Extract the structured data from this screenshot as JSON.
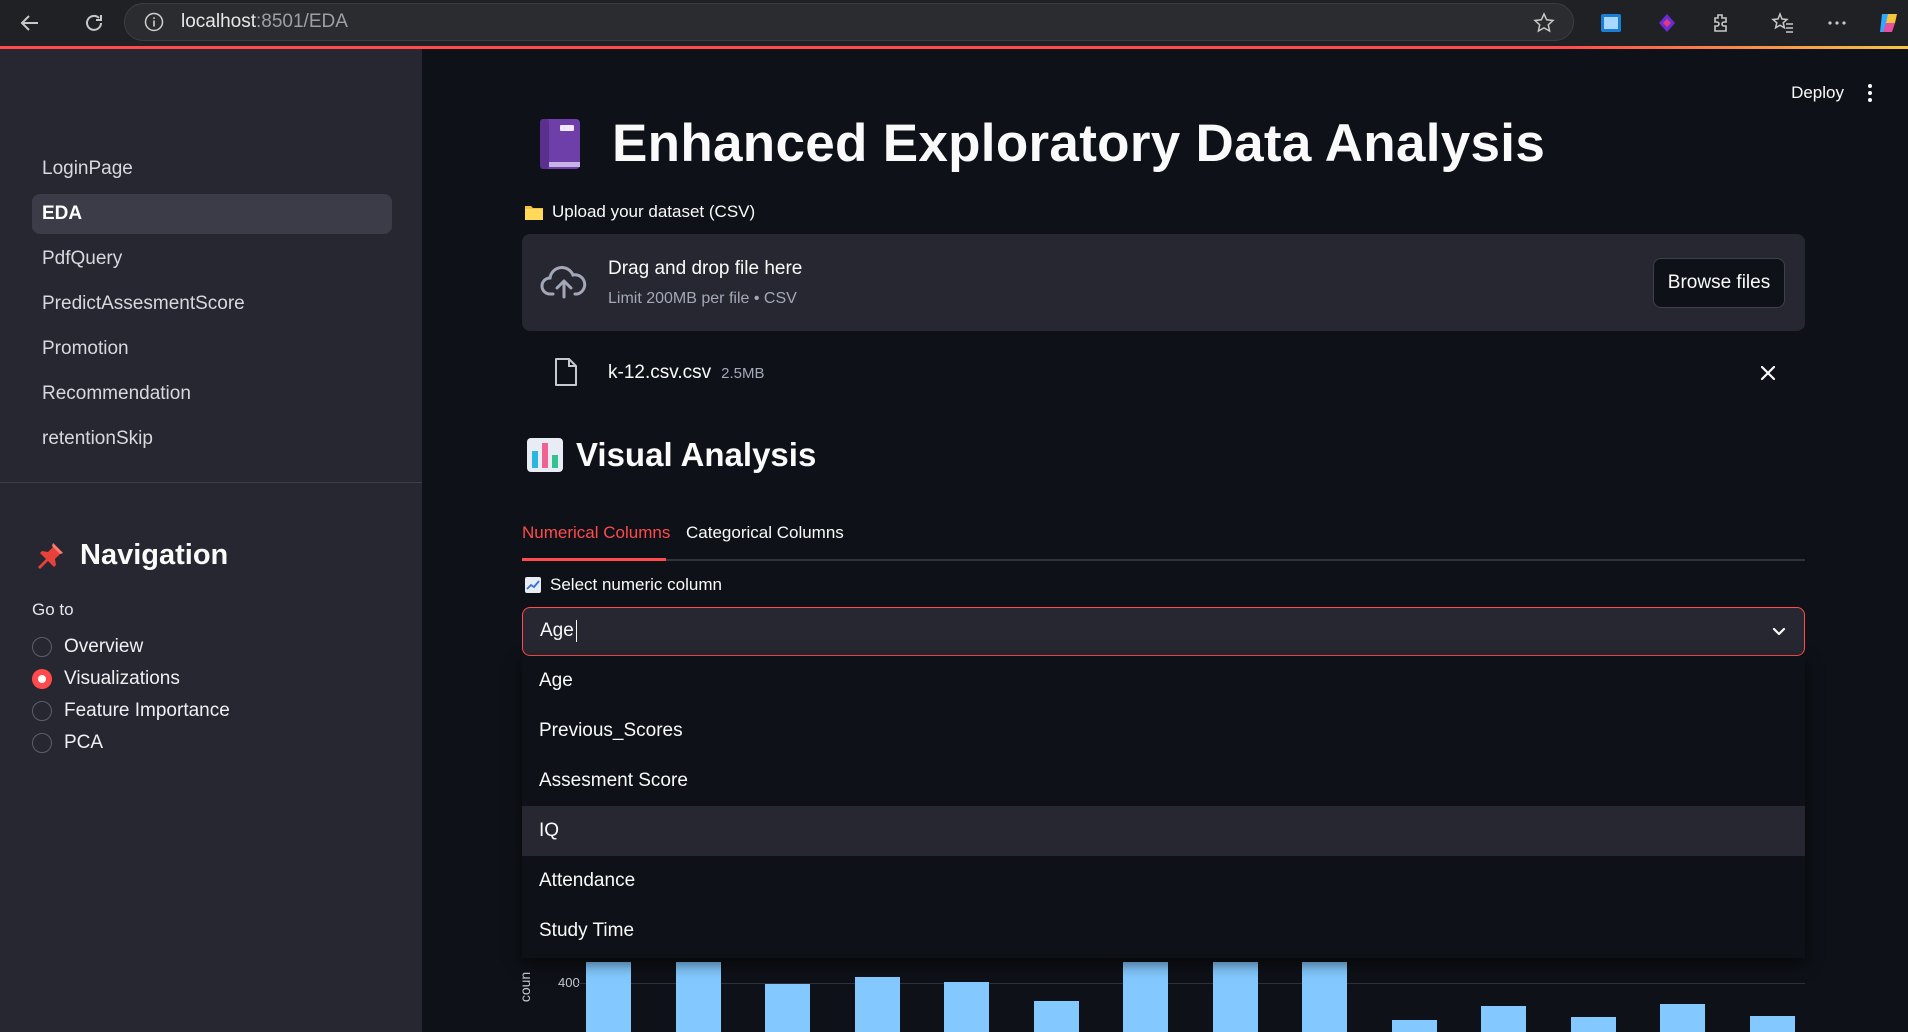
{
  "browser": {
    "url_host": "localhost",
    "url_rest": ":8501/EDA"
  },
  "sidebar": {
    "pages": [
      {
        "label": "LoginPage",
        "active": false
      },
      {
        "label": "EDA",
        "active": true
      },
      {
        "label": "PdfQuery",
        "active": false
      },
      {
        "label": "PredictAssesmentScore",
        "active": false
      },
      {
        "label": "Promotion",
        "active": false
      },
      {
        "label": "Recommendation",
        "active": false
      },
      {
        "label": "retentionSkip",
        "active": false
      }
    ],
    "navigation_title": "Navigation",
    "goto_label": "Go to",
    "radio_options": [
      {
        "label": "Overview",
        "selected": false
      },
      {
        "label": "Visualizations",
        "selected": true
      },
      {
        "label": "Feature Importance",
        "selected": false
      },
      {
        "label": "PCA",
        "selected": false
      }
    ]
  },
  "header": {
    "deploy_label": "Deploy"
  },
  "main": {
    "title": "Enhanced Exploratory Data Analysis",
    "upload_label": "Upload your dataset (CSV)",
    "dropzone": {
      "title": "Drag and drop file here",
      "subtitle": "Limit 200MB per file • CSV",
      "browse_label": "Browse files"
    },
    "file": {
      "name": "k-12.csv.csv",
      "size": "2.5MB"
    },
    "section_title": "Visual Analysis",
    "tabs": [
      {
        "label": "Numerical Columns",
        "active": true
      },
      {
        "label": "Categorical Columns",
        "active": false
      }
    ],
    "select_label": "Select numeric column",
    "select_value": "Age",
    "options": [
      "Age",
      "Previous_Scores",
      "Assesment Score",
      "IQ",
      "Attendance",
      "Study Time"
    ],
    "highlighted_option": "IQ"
  },
  "chart_data": {
    "type": "bar",
    "ylabel": "coun",
    "y_ticks": [
      "400"
    ],
    "values": [
      480,
      480,
      330,
      380,
      340,
      210,
      480,
      480,
      480,
      80,
      180,
      100,
      190,
      110
    ],
    "bar_color": "#83c9ff"
  },
  "colors": {
    "accent": "#ff4b4b",
    "sidebar_bg": "#262730",
    "main_bg": "#0e1117"
  }
}
